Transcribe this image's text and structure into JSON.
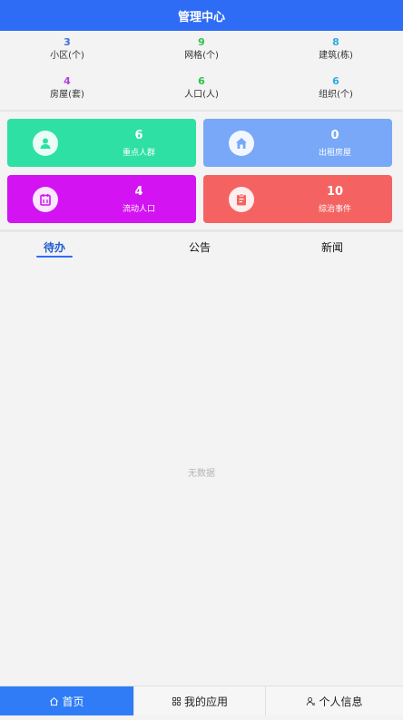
{
  "header": {
    "title": "管理中心"
  },
  "stats": [
    {
      "value": "3",
      "label": "小区(个)",
      "color": "#3c6fde"
    },
    {
      "value": "9",
      "label": "网格(个)",
      "color": "#2ec24a"
    },
    {
      "value": "8",
      "label": "建筑(栋)",
      "color": "#2fa9e6"
    },
    {
      "value": "4",
      "label": "房屋(套)",
      "color": "#b43fe0"
    },
    {
      "value": "6",
      "label": "人口(人)",
      "color": "#2ec24a"
    },
    {
      "value": "6",
      "label": "组织(个)",
      "color": "#2fa9e6"
    }
  ],
  "cards": [
    {
      "value": "6",
      "label": "重点人群",
      "color": "#2ee0a4",
      "icon": "person-icon"
    },
    {
      "value": "0",
      "label": "出租房屋",
      "color": "#78a8f7",
      "icon": "house-icon"
    },
    {
      "value": "4",
      "label": "流动人口",
      "color": "#d313f2",
      "icon": "calendar-icon"
    },
    {
      "value": "10",
      "label": "综治事件",
      "color": "#f56262",
      "icon": "clipboard-icon"
    }
  ],
  "tabs": [
    {
      "label": "待办"
    },
    {
      "label": "公告"
    },
    {
      "label": "新闻"
    }
  ],
  "empty_text": "无数据",
  "bottom_nav": [
    {
      "label": "首页",
      "icon": "home-icon"
    },
    {
      "label": "我的应用",
      "icon": "apps-icon"
    },
    {
      "label": "个人信息",
      "icon": "user-icon"
    }
  ]
}
